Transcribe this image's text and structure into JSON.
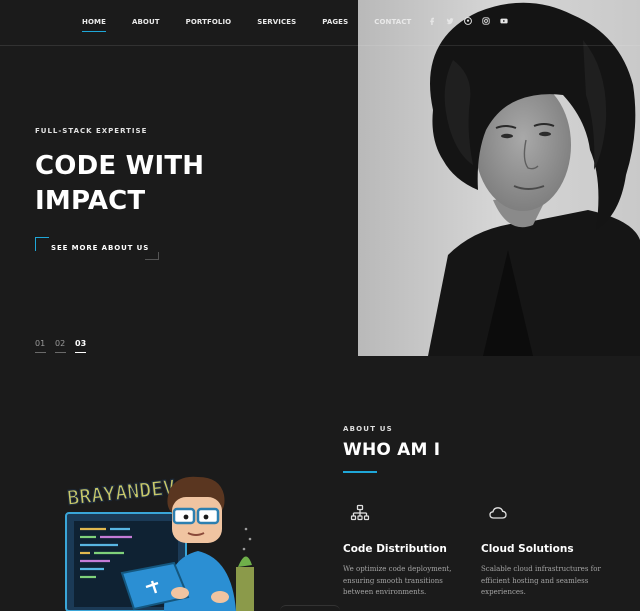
{
  "nav": {
    "items": [
      {
        "label": "HOME",
        "active": true
      },
      {
        "label": "ABOUT",
        "active": false
      },
      {
        "label": "PORTFOLIO",
        "active": false
      },
      {
        "label": "SERVICES",
        "active": false
      },
      {
        "label": "PAGES",
        "active": false
      },
      {
        "label": "CONTACT",
        "active": false
      }
    ],
    "social_icons": [
      "facebook-icon",
      "twitter-icon",
      "pinterest-icon",
      "instagram-icon",
      "youtube-icon"
    ]
  },
  "hero": {
    "eyebrow": "FULL-STACK EXPERTISE",
    "title_line1": "CODE WITH",
    "title_line2": "IMPACT",
    "button_label": "SEE MORE ABOUT US",
    "slides": [
      "01",
      "02",
      "03"
    ],
    "active_slide": "03"
  },
  "about": {
    "eyebrow": "ABOUT US",
    "title": "WHO AM I",
    "mascot_text": "BRAYANDEV",
    "features": [
      {
        "icon": "network-icon",
        "title": "Code Distribution",
        "desc": "We optimize code deployment, ensuring smooth transitions between environments."
      },
      {
        "icon": "cloud-icon",
        "title": "Cloud Solutions",
        "desc": "Scalable cloud infrastructures for efficient hosting and seamless experiences."
      }
    ]
  },
  "colors": {
    "accent": "#1fa7d8",
    "background": "#1b1b1b",
    "text": "#ffffff",
    "muted": "#a3a3a3"
  }
}
